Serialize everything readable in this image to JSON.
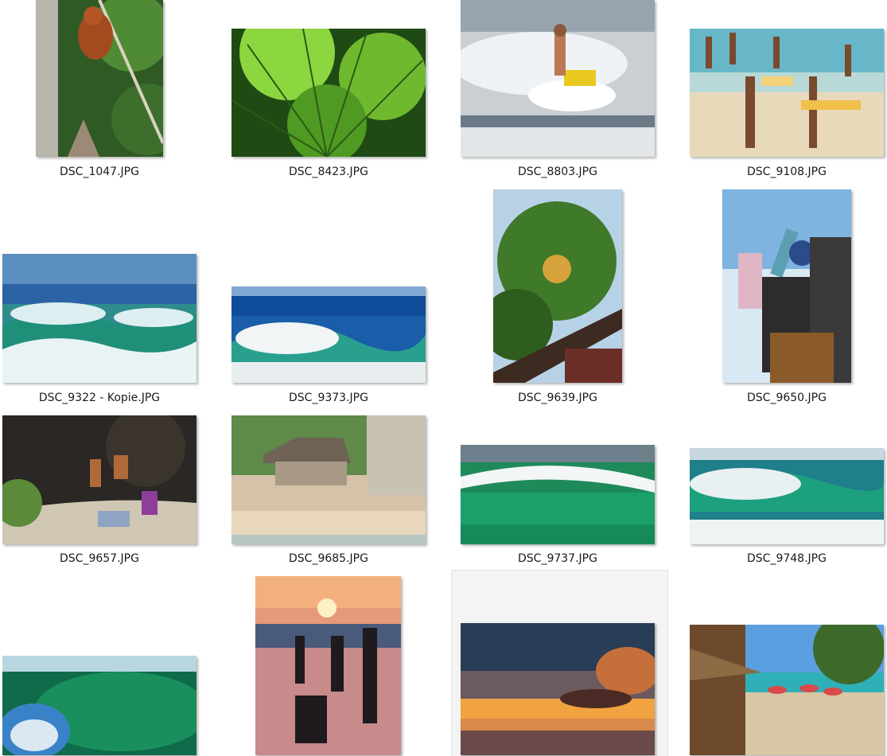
{
  "files": [
    {
      "name": "DSC_1047.JPG",
      "subject": "orangutan"
    },
    {
      "name": "DSC_8423.JPG",
      "subject": "palm-leaf"
    },
    {
      "name": "DSC_8803.JPG",
      "subject": "jetski"
    },
    {
      "name": "DSC_9108.JPG",
      "subject": "beach-people"
    },
    {
      "name": "DSC_9322 - Kopie.JPG",
      "subject": "surfers"
    },
    {
      "name": "DSC_9373.JPG",
      "subject": "wave-jump"
    },
    {
      "name": "DSC_9639.JPG",
      "subject": "coconut-palm"
    },
    {
      "name": "DSC_9650.JPG",
      "subject": "photographers"
    },
    {
      "name": "DSC_9657.JPG",
      "subject": "cliff-people"
    },
    {
      "name": "DSC_9685.JPG",
      "subject": "beach-hut"
    },
    {
      "name": "DSC_9737.JPG",
      "subject": "green-wave"
    },
    {
      "name": "DSC_9748.JPG",
      "subject": "wave-surfer"
    },
    {
      "name": "",
      "subject": "barrel-wave"
    },
    {
      "name": "",
      "subject": "sunset-couple"
    },
    {
      "name": "",
      "subject": "sunset-clouds"
    },
    {
      "name": "",
      "subject": "beach-umbrellas"
    }
  ]
}
